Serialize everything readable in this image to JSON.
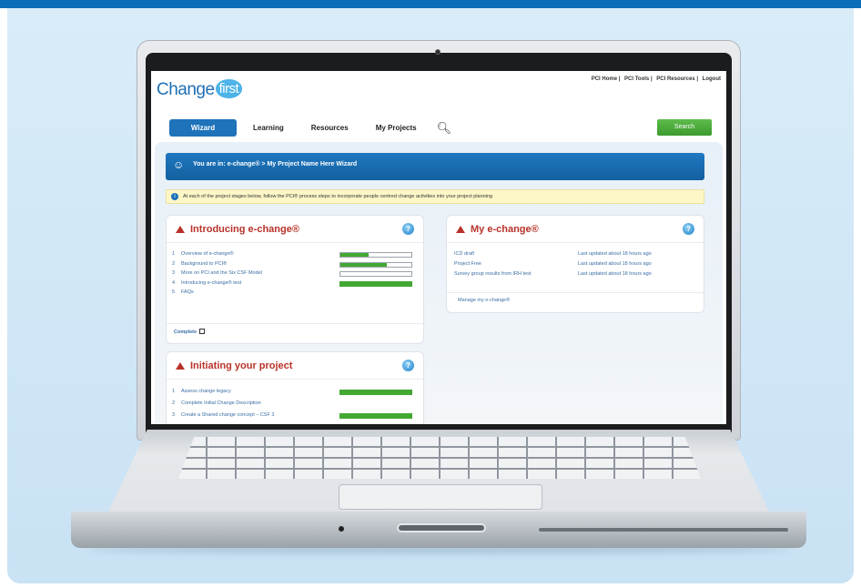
{
  "colors": {
    "brand_blue": "#1e73b9",
    "accent_green": "#42a832",
    "title_red": "#b8322a",
    "info_yellow": "#fdf7c8"
  },
  "header": {
    "logo_main": "Change",
    "logo_accent": "first",
    "util_links": [
      "PCI Home",
      "PCI Tools",
      "PCI Resources",
      "Logout"
    ]
  },
  "nav": {
    "tabs": [
      "Wizard",
      "Learning",
      "Resources",
      "My Projects"
    ],
    "active_tab": "Wizard",
    "search_button": "Search"
  },
  "breadcrumb": "You are in: e-change® > My Project Name Here Wizard",
  "info_text": "At each of the project stages below, follow the PCI® process steps to incorporate people centred change activities into your project planning",
  "panel_intro": {
    "title": "Introducing e-change®",
    "items": [
      {
        "num": "1",
        "label": "Overview of e-change®",
        "progress": 0.4
      },
      {
        "num": "2",
        "label": "Background to PCI®",
        "progress": 0.65
      },
      {
        "num": "3",
        "label": "More on PCI and the Six CSF Model",
        "progress": 0.0
      },
      {
        "num": "4",
        "label": "Introducing e-change® test",
        "progress": 1.0
      },
      {
        "num": "5",
        "label": "FAQs",
        "progress": null
      }
    ],
    "complete_label": "Complete"
  },
  "panel_initiating": {
    "title": "Initiating your project",
    "items": [
      {
        "num": "1",
        "label": "Assess change legacy",
        "progress": 1.0
      },
      {
        "num": "2",
        "label": "Complete Initial Change Description",
        "progress": null
      },
      {
        "num": "3",
        "label": "Create a Shared change concept – CSF 3",
        "progress": 1.0
      }
    ]
  },
  "panel_my": {
    "title": "My e-change®",
    "items": [
      {
        "label": "ICD draft",
        "updated": "Last updated about 18 hours ago"
      },
      {
        "label": "Project Free",
        "updated": "Last updated about 18 hours ago"
      },
      {
        "label": "Survey group results from IRH test",
        "updated": "Last updated about 18 hours ago"
      }
    ],
    "manage_label": "Manage my e-change®"
  }
}
